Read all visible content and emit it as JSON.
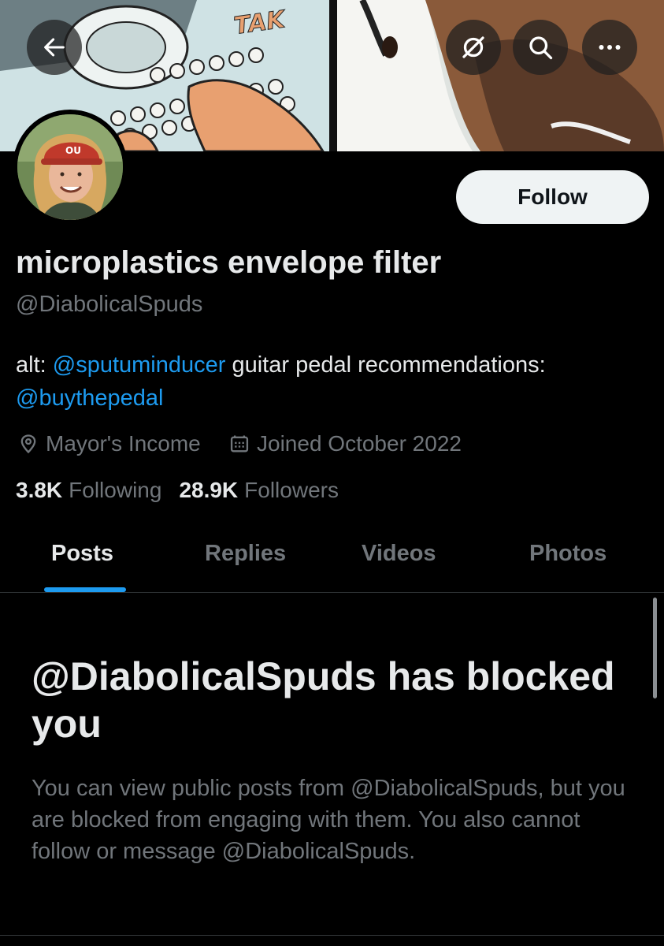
{
  "header": {
    "back_icon": "arrow-left-icon",
    "grok_icon": "slash-circle-icon",
    "search_icon": "search-icon",
    "more_icon": "more-horizontal-icon"
  },
  "banner": {
    "sfx_text": "TAK"
  },
  "profile": {
    "follow_label": "Follow",
    "display_name": "microplastics envelope filter",
    "handle": "@DiabolicalSpuds",
    "bio": {
      "prefix": "alt: ",
      "mention1": "@sputuminducer",
      "middle": " guitar pedal recommendations: ",
      "mention2": "@buythepedal"
    },
    "location": "Mayor's Income",
    "joined": "Joined October 2022",
    "following_count": "3.8K",
    "following_label": "Following",
    "followers_count": "28.9K",
    "followers_label": "Followers"
  },
  "tabs": [
    {
      "label": "Posts",
      "active": true
    },
    {
      "label": "Replies",
      "active": false
    },
    {
      "label": "Videos",
      "active": false
    },
    {
      "label": "Photos",
      "active": false
    }
  ],
  "blocked": {
    "title": "@DiabolicalSpuds has blocked you",
    "description": "You can view public posts from @DiabolicalSpuds, but you are blocked from engaging with them. You also cannot follow or message @DiabolicalSpuds."
  },
  "colors": {
    "background": "#000000",
    "accent": "#1d9bf0",
    "primary_text": "#e7e9ea",
    "secondary_text": "#71767b"
  }
}
